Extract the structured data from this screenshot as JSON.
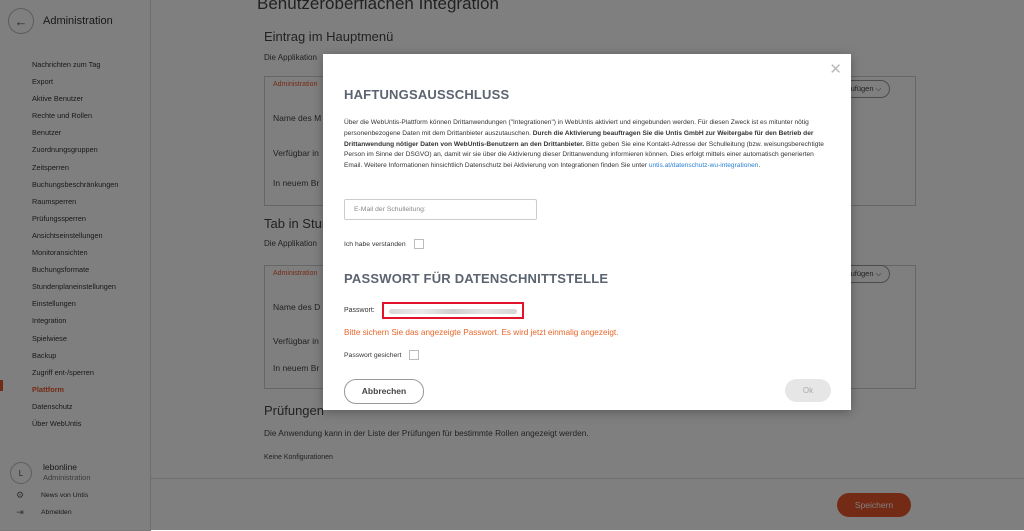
{
  "sidebar": {
    "back_icon": "arrow-left-icon",
    "title": "Administration",
    "items": [
      {
        "label": "Nachrichten zum Tag"
      },
      {
        "label": "Export"
      },
      {
        "label": "Aktive Benutzer"
      },
      {
        "label": "Rechte und Rollen"
      },
      {
        "label": "Benutzer"
      },
      {
        "label": "Zuordnungsgruppen"
      },
      {
        "label": "Zeitsperren"
      },
      {
        "label": "Buchungsbeschränkungen"
      },
      {
        "label": "Raumsperren"
      },
      {
        "label": "Prüfungssperren"
      },
      {
        "label": "Ansichtseinstellungen"
      },
      {
        "label": "Monitoransichten"
      },
      {
        "label": "Buchungsformate"
      },
      {
        "label": "Stundenplaneinstellungen"
      },
      {
        "label": "Einstellungen"
      },
      {
        "label": "Integration"
      },
      {
        "label": "Spielwiese"
      },
      {
        "label": "Backup"
      },
      {
        "label": "Zugriff ent-/sperren"
      },
      {
        "label": "Plattform",
        "active": true
      },
      {
        "label": "Datenschutz"
      },
      {
        "label": "Über WebUntis"
      }
    ],
    "user": {
      "initial": "L",
      "name": "lebonline",
      "role": "Administration"
    },
    "news_label": "News von Untis",
    "logout_label": "Abmelden"
  },
  "main": {
    "page_title": "Benutzeroberflächen Integration",
    "section1_title": "Eintrag im Hauptmenü",
    "section1_desc": "Die Applikation",
    "card_tag": "Administration",
    "row_name": "Name des M",
    "row_name2": "Name des D",
    "row_available": "Verfügbar in",
    "row_new_tab": "In neuem Br",
    "add_label": "inzufügen",
    "section2_title": "Tab in Stun",
    "section2_desc": "Die Applikation",
    "section3_title": "Prüfungen",
    "section3_desc": "Die Anwendung kann in der Liste der Prüfungen für bestimmte Rollen angezeigt werden.",
    "no_configs": "Keine Konfigurationen",
    "save_label": "Speichern"
  },
  "modal": {
    "disclaimer_title": "HAFTUNGSAUSSCHLUSS",
    "disclaimer_text_1": "Über die WebUntis-Plattform können Drittanwendungen (\"Integrationen\") in WebUntis aktiviert und eingebunden werden. Für diesen Zweck ist es mitunter nötig personenbezogene Daten mit dem Drittanbieter auszutauschen. ",
    "disclaimer_bold": "Durch die Aktivierung beauftragen Sie die Untis GmbH zur Weitergabe für den Betrieb der Drittanwendung nötiger Daten von WebUntis-Benutzern an den Drittanbieter.",
    "disclaimer_text_2": " Bitte geben Sie eine Kontakt-Adresse der Schulleitung (bzw. weisungsberechtigte Person im Sinne der DSGVO) an, damit wir sie über die Aktivierung dieser Drittanwendung informieren können. Dies erfolgt mittels einer automatisch generierten Email. Weitere Informationen hinsichtlich Datenschutz bei Aktivierung von Integrationen finden Sie unter ",
    "disclaimer_link": "untis.at/datenschutz-wu-integrationen",
    "disclaimer_end": ".",
    "email_placeholder": "E-Mail der Schulleitung:",
    "understood_label": "Ich habe verstanden",
    "password_title": "PASSWORT FÜR DATENSCHNITTSTELLE",
    "password_label": "Passwort:",
    "password_warning": "Bitte sichern Sie das angezeigte Passwort. Es wird jetzt einmalig angezeigt.",
    "password_saved_label": "Passwort gesichert",
    "cancel_label": "Abbrechen",
    "ok_label": "Ok"
  },
  "colors": {
    "accent": "#e8562a",
    "highlight": "#e2132a",
    "link": "#2a7fd4"
  }
}
